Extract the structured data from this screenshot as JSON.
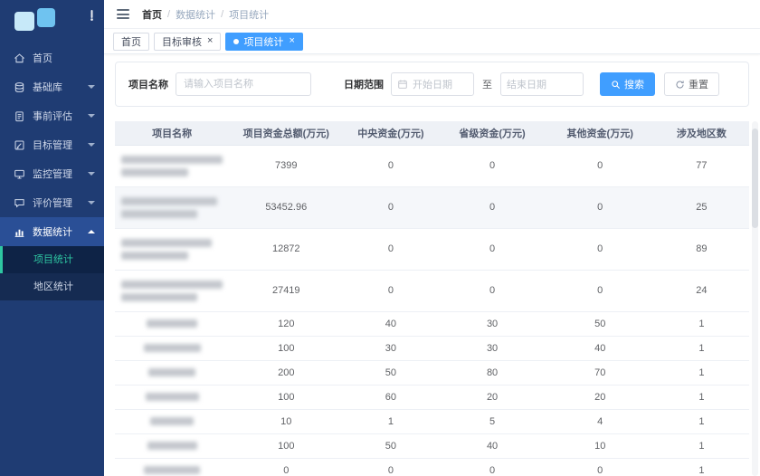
{
  "colors": {
    "accent": "#409eff",
    "sidebar": "#1f3c73",
    "active_green": "#2ec7a2"
  },
  "sidebar": {
    "items": [
      {
        "id": "home",
        "label": "首页",
        "icon": "home"
      },
      {
        "id": "base-library",
        "label": "基础库",
        "icon": "database",
        "chevron": true
      },
      {
        "id": "pre-assessment",
        "label": "事前评估",
        "icon": "clipboard",
        "chevron": true
      },
      {
        "id": "target-management",
        "label": "目标管理",
        "icon": "edit",
        "chevron": true
      },
      {
        "id": "monitor-management",
        "label": "监控管理",
        "icon": "monitor",
        "chevron": true
      },
      {
        "id": "evaluation-management",
        "label": "评价管理",
        "icon": "comment",
        "chevron": true
      },
      {
        "id": "data-statistics",
        "label": "数据统计",
        "icon": "chart",
        "chevron": true,
        "active": true,
        "expanded": true,
        "children": [
          {
            "id": "project-statistics",
            "label": "项目统计",
            "active": true
          },
          {
            "id": "region-statistics",
            "label": "地区统计"
          }
        ]
      }
    ]
  },
  "breadcrumb": [
    "首页",
    "数据统计",
    "项目统计"
  ],
  "tabs": [
    {
      "id": "home",
      "label": "首页"
    },
    {
      "id": "target-review",
      "label": "目标审核",
      "closable": true
    },
    {
      "id": "project-statistics",
      "label": "项目统计",
      "closable": true,
      "active": true
    }
  ],
  "filters": {
    "project_name_label": "项目名称",
    "project_name_placeholder": "请输入项目名称",
    "date_range_label": "日期范围",
    "start_placeholder": "开始日期",
    "to_label": "至",
    "end_placeholder": "结束日期",
    "search_label": "搜索",
    "reset_label": "重置"
  },
  "table": {
    "columns": [
      "项目名称",
      "项目资金总额(万元)",
      "中央资金(万元)",
      "省级资金(万元)",
      "其他资金(万元)",
      "涉及地区数"
    ],
    "rows": [
      {
        "name_redacted": true,
        "name_lines": 2,
        "values": [
          "7399",
          "0",
          "0",
          "0",
          "77"
        ]
      },
      {
        "name_redacted": true,
        "name_lines": 2,
        "hover": true,
        "values": [
          "53452.96",
          "0",
          "0",
          "0",
          "25"
        ]
      },
      {
        "name_redacted": true,
        "name_lines": 2,
        "values": [
          "12872",
          "0",
          "0",
          "0",
          "89"
        ]
      },
      {
        "name_redacted": true,
        "name_lines": 2,
        "values": [
          "27419",
          "0",
          "0",
          "0",
          "24"
        ]
      },
      {
        "name_redacted": true,
        "name_lines": 1,
        "values": [
          "120",
          "40",
          "30",
          "50",
          "1"
        ]
      },
      {
        "name_redacted": true,
        "name_lines": 1,
        "values": [
          "100",
          "30",
          "30",
          "40",
          "1"
        ]
      },
      {
        "name_redacted": true,
        "name_lines": 1,
        "values": [
          "200",
          "50",
          "80",
          "70",
          "1"
        ]
      },
      {
        "name_redacted": true,
        "name_lines": 1,
        "values": [
          "100",
          "60",
          "20",
          "20",
          "1"
        ]
      },
      {
        "name_redacted": true,
        "name_lines": 1,
        "values": [
          "10",
          "1",
          "5",
          "4",
          "1"
        ]
      },
      {
        "name_redacted": true,
        "name_lines": 1,
        "values": [
          "100",
          "50",
          "40",
          "10",
          "1"
        ]
      },
      {
        "name_redacted": true,
        "name_lines": 1,
        "values": [
          "0",
          "0",
          "0",
          "0",
          "1"
        ]
      }
    ]
  }
}
